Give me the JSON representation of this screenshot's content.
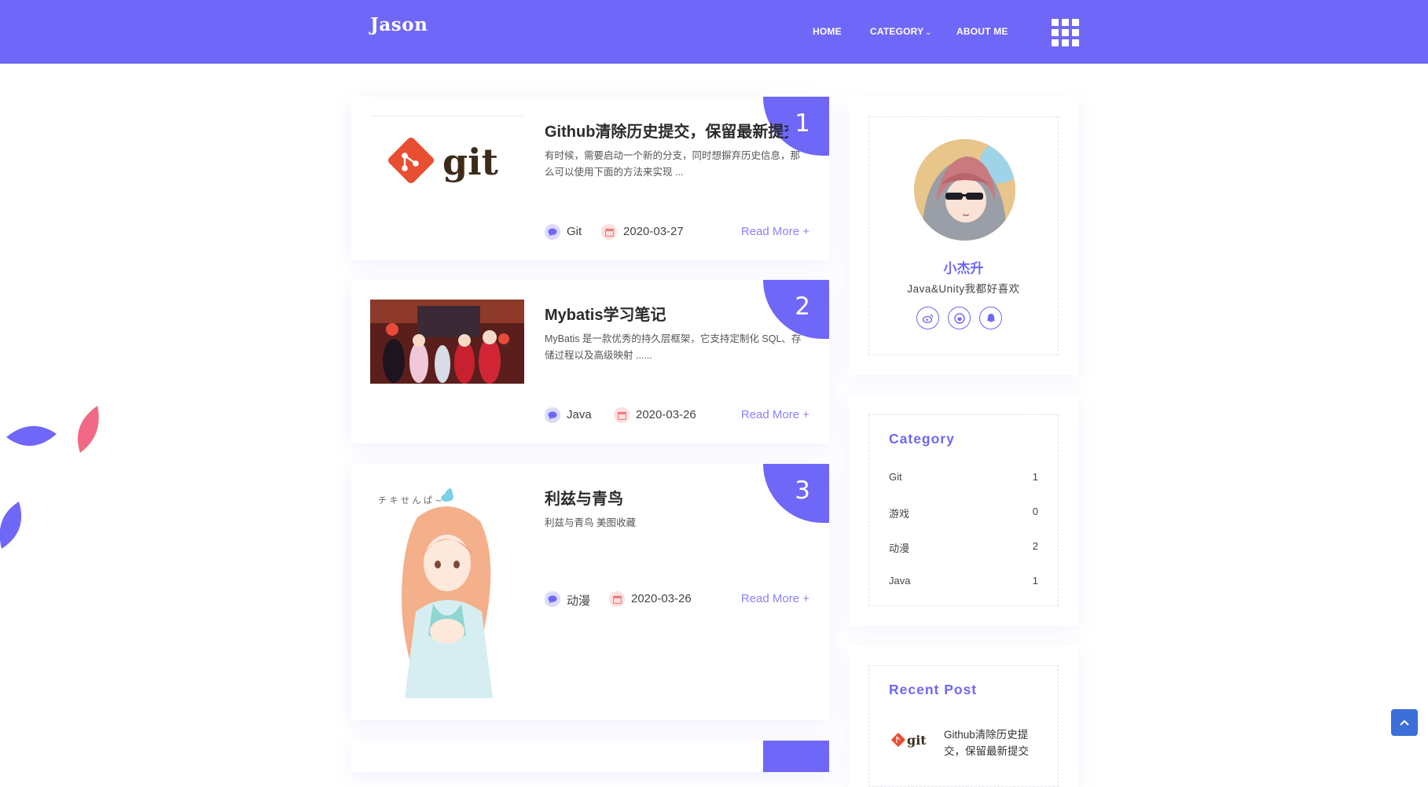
{
  "header": {
    "brand": "Jason",
    "nav": {
      "home": "HOME",
      "category": "CATEGORY",
      "about": "ABOUT ME"
    }
  },
  "posts": [
    {
      "number": "1",
      "title": "Github清除历史提交，保留最新提交",
      "excerpt": "有时候，需要启动一个新的分支，同时想摒弃历史信息，那么可以使用下面的方法来实现 ...",
      "thumb_text": "git",
      "category": "Git",
      "date": "2020-03-27",
      "read_more": "Read More +"
    },
    {
      "number": "2",
      "title": "Mybatis学习笔记",
      "excerpt": "MyBatis 是一款优秀的持久层框架，它支持定制化 SQL、存储过程以及高级映射 ......",
      "category": "Java",
      "date": "2020-03-26",
      "read_more": "Read More +"
    },
    {
      "number": "3",
      "title": "利兹与青鸟",
      "excerpt": "利兹与青鸟 美图收藏",
      "category": "动漫",
      "date": "2020-03-26",
      "read_more": "Read More +"
    }
  ],
  "profile": {
    "name": "小杰升",
    "bio": "Java&Unity我都好喜欢",
    "social": [
      "weibo-icon",
      "github-icon",
      "qq-icon"
    ]
  },
  "categories": {
    "heading": "Category",
    "items": [
      {
        "name": "Git",
        "count": "1"
      },
      {
        "name": "游戏",
        "count": "0"
      },
      {
        "name": "动漫",
        "count": "2"
      },
      {
        "name": "Java",
        "count": "1"
      }
    ]
  },
  "recent": {
    "heading": "Recent Post",
    "items": [
      {
        "thumb_text": "git",
        "title": "Github清除历史提交，保留最新提交"
      }
    ]
  },
  "colors": {
    "accent": "#6f67f7",
    "header_bg": "#6f67f7",
    "leaf_pink": "#f06a86",
    "to_top": "#3c6fd8"
  }
}
